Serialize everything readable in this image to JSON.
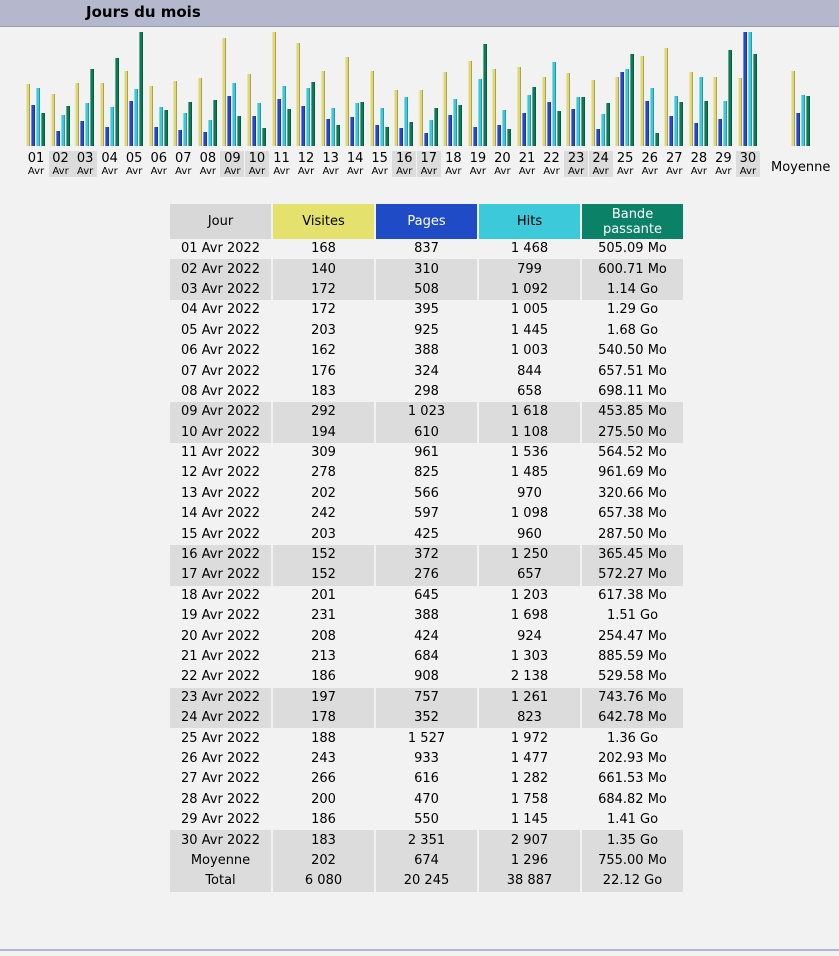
{
  "section_title": "Jours du mois",
  "chart_avg_label": "Moyenne",
  "colors": {
    "visits": "#e0d874",
    "pages": "#2948c8",
    "hits": "#3cc8d8",
    "bandwidth": "#0b7a55"
  },
  "chart_data": {
    "type": "bar",
    "categories": [
      "01",
      "02",
      "03",
      "04",
      "05",
      "06",
      "07",
      "08",
      "09",
      "10",
      "11",
      "12",
      "13",
      "14",
      "15",
      "16",
      "17",
      "18",
      "19",
      "20",
      "21",
      "22",
      "23",
      "24",
      "25",
      "26",
      "27",
      "28",
      "29",
      "30",
      "Moyenne"
    ],
    "month_label": "Avr",
    "weekend_days": [
      "02",
      "03",
      "09",
      "10",
      "16",
      "17",
      "23",
      "24",
      "30"
    ],
    "series": [
      {
        "name": "Visites",
        "values": [
          168,
          140,
          172,
          172,
          203,
          162,
          176,
          183,
          292,
          194,
          309,
          278,
          202,
          242,
          203,
          152,
          152,
          201,
          231,
          208,
          213,
          186,
          197,
          178,
          188,
          243,
          266,
          200,
          186,
          183,
          202
        ]
      },
      {
        "name": "Pages",
        "values": [
          837,
          310,
          508,
          395,
          925,
          388,
          324,
          298,
          1023,
          610,
          961,
          825,
          566,
          597,
          425,
          372,
          276,
          645,
          388,
          424,
          684,
          908,
          757,
          352,
          1527,
          933,
          616,
          470,
          550,
          2351,
          674
        ]
      },
      {
        "name": "Hits",
        "values": [
          1468,
          799,
          1092,
          1005,
          1445,
          1003,
          844,
          658,
          1618,
          1108,
          1536,
          1485,
          970,
          1098,
          960,
          1250,
          657,
          1203,
          1698,
          924,
          1303,
          2138,
          1261,
          823,
          1972,
          1477,
          1282,
          1758,
          1145,
          2907,
          1296
        ]
      },
      {
        "name": "Bande passante",
        "values": [
          505.09,
          600.71,
          1167,
          1321,
          1720,
          540.5,
          657.51,
          698.11,
          453.85,
          275.5,
          564.52,
          961.69,
          320.66,
          657.38,
          287.5,
          365.45,
          572.27,
          617.38,
          1546,
          254.47,
          885.59,
          529.58,
          743.76,
          642.78,
          1393,
          202.93,
          661.53,
          684.82,
          1444,
          1382,
          755.0
        ]
      }
    ]
  },
  "table": {
    "headers": {
      "day": "Jour",
      "visits": "Visites",
      "pages": "Pages",
      "hits": "Hits",
      "bandwidth": "Bande passante"
    },
    "rows": [
      {
        "day": "01 Avr 2022",
        "visits": "168",
        "pages": "837",
        "hits": "1 468",
        "bw": "505.09 Mo",
        "we": false
      },
      {
        "day": "02 Avr 2022",
        "visits": "140",
        "pages": "310",
        "hits": "799",
        "bw": "600.71 Mo",
        "we": true
      },
      {
        "day": "03 Avr 2022",
        "visits": "172",
        "pages": "508",
        "hits": "1 092",
        "bw": "1.14 Go",
        "we": true
      },
      {
        "day": "04 Avr 2022",
        "visits": "172",
        "pages": "395",
        "hits": "1 005",
        "bw": "1.29 Go",
        "we": false
      },
      {
        "day": "05 Avr 2022",
        "visits": "203",
        "pages": "925",
        "hits": "1 445",
        "bw": "1.68 Go",
        "we": false
      },
      {
        "day": "06 Avr 2022",
        "visits": "162",
        "pages": "388",
        "hits": "1 003",
        "bw": "540.50 Mo",
        "we": false
      },
      {
        "day": "07 Avr 2022",
        "visits": "176",
        "pages": "324",
        "hits": "844",
        "bw": "657.51 Mo",
        "we": false
      },
      {
        "day": "08 Avr 2022",
        "visits": "183",
        "pages": "298",
        "hits": "658",
        "bw": "698.11 Mo",
        "we": false
      },
      {
        "day": "09 Avr 2022",
        "visits": "292",
        "pages": "1 023",
        "hits": "1 618",
        "bw": "453.85 Mo",
        "we": true
      },
      {
        "day": "10 Avr 2022",
        "visits": "194",
        "pages": "610",
        "hits": "1 108",
        "bw": "275.50 Mo",
        "we": true
      },
      {
        "day": "11 Avr 2022",
        "visits": "309",
        "pages": "961",
        "hits": "1 536",
        "bw": "564.52 Mo",
        "we": false
      },
      {
        "day": "12 Avr 2022",
        "visits": "278",
        "pages": "825",
        "hits": "1 485",
        "bw": "961.69 Mo",
        "we": false
      },
      {
        "day": "13 Avr 2022",
        "visits": "202",
        "pages": "566",
        "hits": "970",
        "bw": "320.66 Mo",
        "we": false
      },
      {
        "day": "14 Avr 2022",
        "visits": "242",
        "pages": "597",
        "hits": "1 098",
        "bw": "657.38 Mo",
        "we": false
      },
      {
        "day": "15 Avr 2022",
        "visits": "203",
        "pages": "425",
        "hits": "960",
        "bw": "287.50 Mo",
        "we": false
      },
      {
        "day": "16 Avr 2022",
        "visits": "152",
        "pages": "372",
        "hits": "1 250",
        "bw": "365.45 Mo",
        "we": true
      },
      {
        "day": "17 Avr 2022",
        "visits": "152",
        "pages": "276",
        "hits": "657",
        "bw": "572.27 Mo",
        "we": true
      },
      {
        "day": "18 Avr 2022",
        "visits": "201",
        "pages": "645",
        "hits": "1 203",
        "bw": "617.38 Mo",
        "we": false
      },
      {
        "day": "19 Avr 2022",
        "visits": "231",
        "pages": "388",
        "hits": "1 698",
        "bw": "1.51 Go",
        "we": false
      },
      {
        "day": "20 Avr 2022",
        "visits": "208",
        "pages": "424",
        "hits": "924",
        "bw": "254.47 Mo",
        "we": false
      },
      {
        "day": "21 Avr 2022",
        "visits": "213",
        "pages": "684",
        "hits": "1 303",
        "bw": "885.59 Mo",
        "we": false
      },
      {
        "day": "22 Avr 2022",
        "visits": "186",
        "pages": "908",
        "hits": "2 138",
        "bw": "529.58 Mo",
        "we": false
      },
      {
        "day": "23 Avr 2022",
        "visits": "197",
        "pages": "757",
        "hits": "1 261",
        "bw": "743.76 Mo",
        "we": true
      },
      {
        "day": "24 Avr 2022",
        "visits": "178",
        "pages": "352",
        "hits": "823",
        "bw": "642.78 Mo",
        "we": true
      },
      {
        "day": "25 Avr 2022",
        "visits": "188",
        "pages": "1 527",
        "hits": "1 972",
        "bw": "1.36 Go",
        "we": false
      },
      {
        "day": "26 Avr 2022",
        "visits": "243",
        "pages": "933",
        "hits": "1 477",
        "bw": "202.93 Mo",
        "we": false
      },
      {
        "day": "27 Avr 2022",
        "visits": "266",
        "pages": "616",
        "hits": "1 282",
        "bw": "661.53 Mo",
        "we": false
      },
      {
        "day": "28 Avr 2022",
        "visits": "200",
        "pages": "470",
        "hits": "1 758",
        "bw": "684.82 Mo",
        "we": false
      },
      {
        "day": "29 Avr 2022",
        "visits": "186",
        "pages": "550",
        "hits": "1 145",
        "bw": "1.41 Go",
        "we": false
      },
      {
        "day": "30 Avr 2022",
        "visits": "183",
        "pages": "2 351",
        "hits": "2 907",
        "bw": "1.35 Go",
        "we": true
      }
    ],
    "summary": [
      {
        "day": "Moyenne",
        "visits": "202",
        "pages": "674",
        "hits": "1 296",
        "bw": "755.00 Mo"
      },
      {
        "day": "Total",
        "visits": "6 080",
        "pages": "20 245",
        "hits": "38 887",
        "bw": "22.12 Go"
      }
    ]
  }
}
